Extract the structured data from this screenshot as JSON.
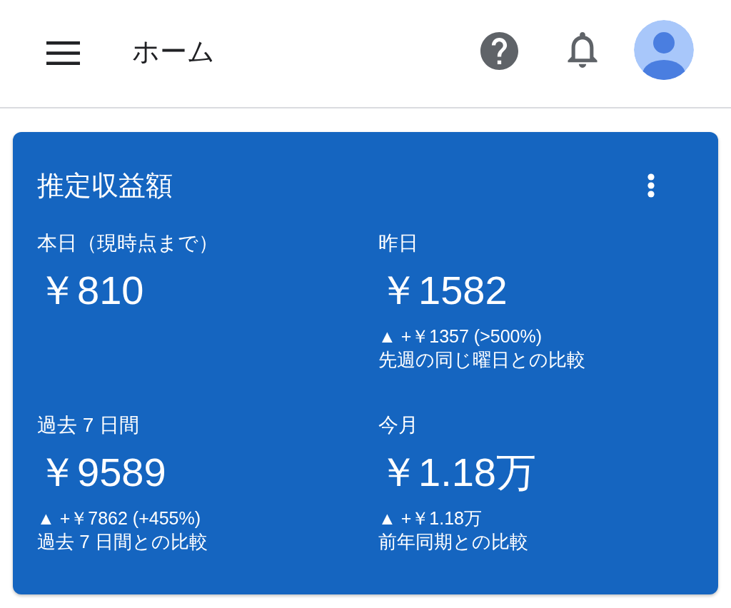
{
  "app_bar": {
    "title": "ホーム"
  },
  "card": {
    "title": "推定収益額",
    "stats": [
      {
        "label": "本日（現時点まで）",
        "value": "￥810"
      },
      {
        "label": "昨日",
        "value": "￥1582",
        "change": "▲ +￥1357 (>500%)",
        "comparison": "先週の同じ曜日との比較"
      },
      {
        "label": "過去 7 日間",
        "value": "￥9589",
        "change": "▲ +￥7862 (+455%)",
        "comparison": "過去 7 日間との比較"
      },
      {
        "label": "今月",
        "value": "￥1.18万",
        "change": "▲ +￥1.18万",
        "comparison": "前年同期との比較"
      }
    ]
  }
}
